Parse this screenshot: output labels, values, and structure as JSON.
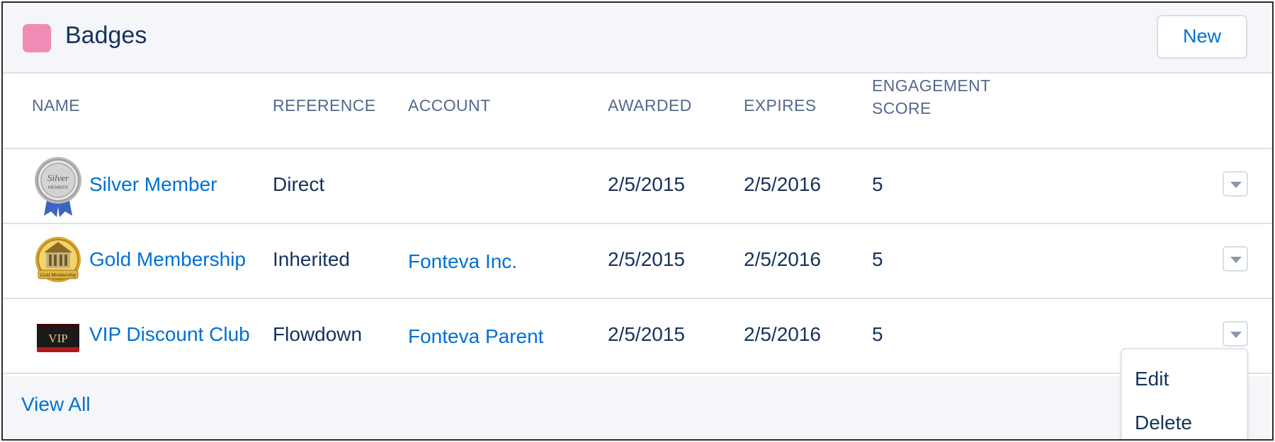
{
  "header": {
    "title": "Badges",
    "icon_color": "#f18bb5",
    "new_label": "New"
  },
  "columns": {
    "name": "NAME",
    "reference": "REFERENCE",
    "account": "ACCOUNT",
    "awarded": "AWARDED",
    "expires": "EXPIRES",
    "engagement_line1": "ENGAGEMENT",
    "engagement_line2": "SCORE"
  },
  "rows": [
    {
      "name": "Silver Member",
      "badge_icon": "silver-medal-icon",
      "badge_text_1": "Silver",
      "badge_text_2": "MEMBER",
      "reference": "Direct",
      "account": "",
      "awarded": "2/5/2015",
      "expires": "2/5/2016",
      "score": "5"
    },
    {
      "name": "Gold Membership",
      "badge_icon": "gold-medal-icon",
      "badge_text_1": "Gold Membership",
      "reference": "Inherited",
      "account": "Fonteva Inc.",
      "awarded": "2/5/2015",
      "expires": "2/5/2016",
      "score": "5"
    },
    {
      "name": "VIP Discount Club",
      "badge_icon": "vip-card-icon",
      "badge_text_1": "VIP",
      "reference": "Flowdown",
      "account": "Fonteva Parent",
      "awarded": "2/5/2015",
      "expires": "2/5/2016",
      "score": "5"
    }
  ],
  "footer": {
    "view_all": "View All"
  },
  "dropdown": {
    "items": [
      "Edit",
      "Delete"
    ]
  },
  "colors": {
    "link": "#0070d2",
    "text": "#16325c",
    "header_bg": "#f4f6f9"
  }
}
